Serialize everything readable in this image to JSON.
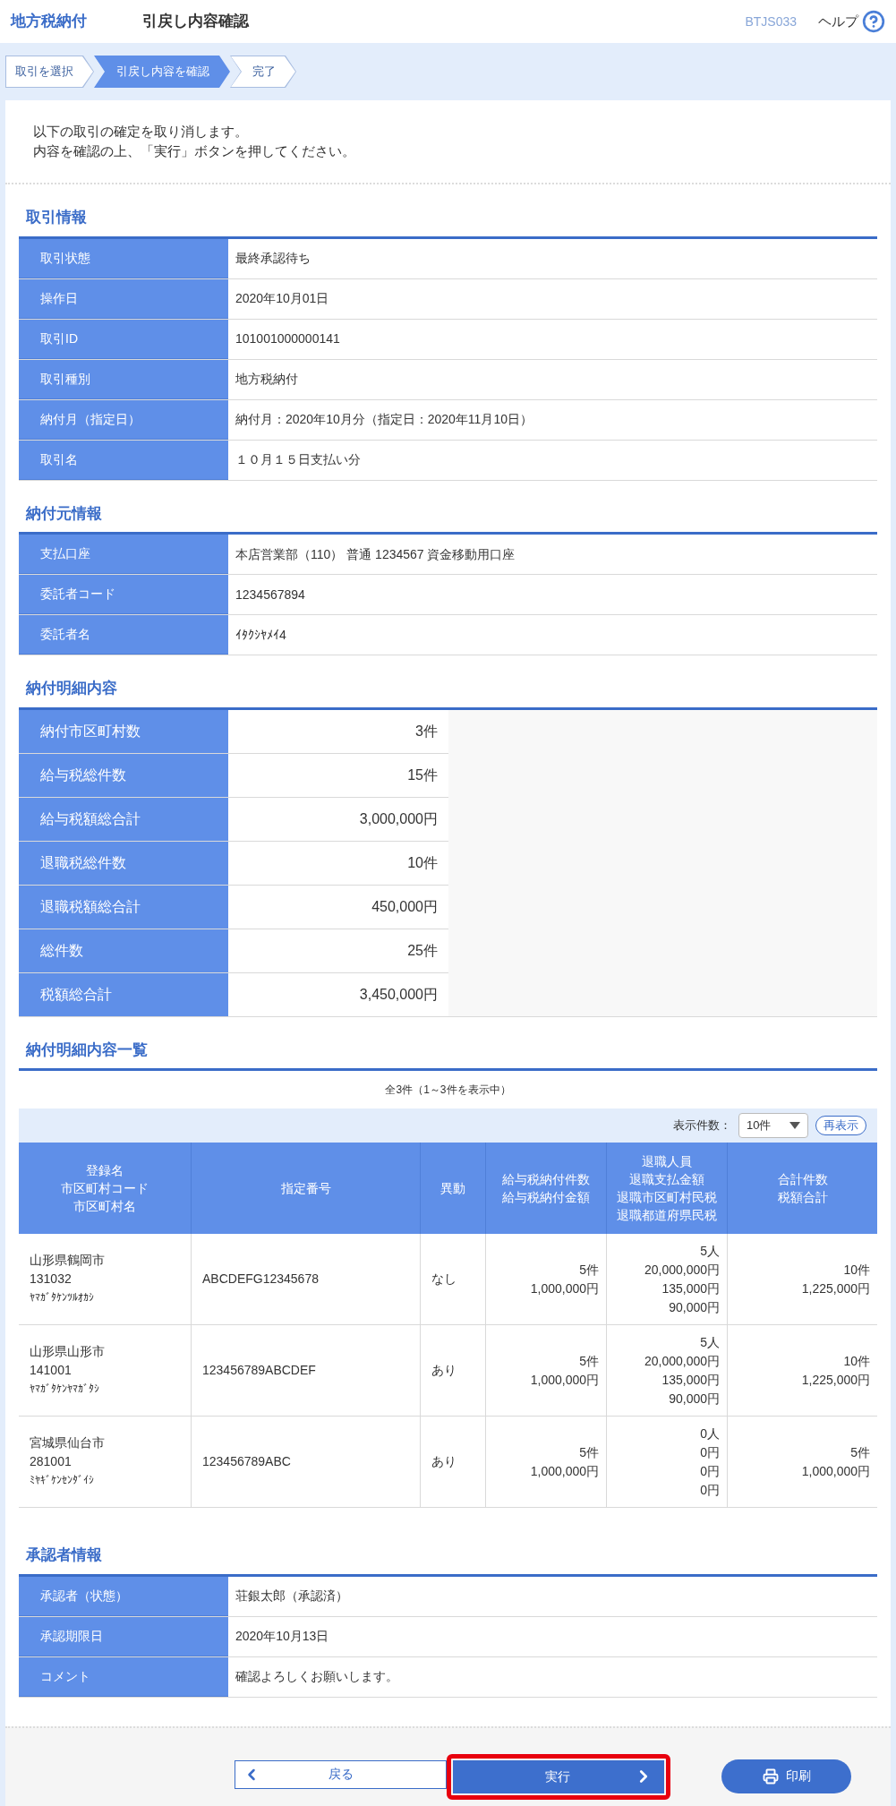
{
  "header": {
    "app_title": "地方税納付",
    "page_title": "引戻し内容確認",
    "screen_id": "BTJS033",
    "help_label": "ヘルプ"
  },
  "steps": [
    {
      "label": "取引を選択",
      "selected": false
    },
    {
      "label": "引戻し内容を確認",
      "selected": true
    },
    {
      "label": "完了",
      "selected": false
    }
  ],
  "message": [
    "以下の取引の確定を取り消します。",
    "内容を確認の上、「実行」ボタンを押してください。"
  ],
  "transaction_info": {
    "title": "取引情報",
    "rows": [
      {
        "label": "取引状態",
        "value": "最終承認待ち"
      },
      {
        "label": "操作日",
        "value": "2020年10月01日"
      },
      {
        "label": "取引ID",
        "value": "101001000000141"
      },
      {
        "label": "取引種別",
        "value": "地方税納付"
      },
      {
        "label": "納付月（指定日）",
        "value": "納付月：2020年10月分（指定日：2020年11月10日）"
      },
      {
        "label": "取引名",
        "value": "１０月１５日支払い分"
      }
    ]
  },
  "payer_info": {
    "title": "納付元情報",
    "rows": [
      {
        "label": "支払口座",
        "value": "本店営業部（110） 普通 1234567 資金移動用口座"
      },
      {
        "label": "委託者コード",
        "value": "1234567894"
      },
      {
        "label": "委託者名",
        "value": "ｲﾀｸｼﾔﾒｲ4"
      }
    ]
  },
  "detail_summary": {
    "title": "納付明細内容",
    "rows": [
      {
        "label": "納付市区町村数",
        "value": "3件"
      },
      {
        "label": "給与税総件数",
        "value": "15件"
      },
      {
        "label": "給与税額総合計",
        "value": "3,000,000円"
      },
      {
        "label": "退職税総件数",
        "value": "10件"
      },
      {
        "label": "退職税額総合計",
        "value": "450,000円"
      },
      {
        "label": "総件数",
        "value": "25件"
      },
      {
        "label": "税額総合計",
        "value": "3,450,000円"
      }
    ]
  },
  "detail_list": {
    "title": "納付明細内容一覧",
    "count_text": "全3件（1～3件を表示中）",
    "per_page_label": "表示件数：",
    "per_page_value": "10件",
    "redisplay_button": "再表示",
    "columns": [
      {
        "lines": [
          "登録名",
          "市区町村コード",
          "市区町村名"
        ]
      },
      {
        "lines": [
          "指定番号"
        ]
      },
      {
        "lines": [
          "異動"
        ]
      },
      {
        "lines": [
          "給与税納付件数",
          "給与税納付金額"
        ]
      },
      {
        "lines": [
          "退職人員",
          "退職支払金額",
          "退職市区町村民税",
          "退職都道府県民税"
        ]
      },
      {
        "lines": [
          "合計件数",
          "税額合計"
        ]
      }
    ],
    "rows": [
      {
        "cells": [
          [
            "山形県鶴岡市",
            "131032",
            "ﾔﾏｶﾞﾀｹﾝﾂﾙｵｶｼ"
          ],
          [
            "ABCDEFG12345678"
          ],
          [
            "なし"
          ],
          [
            "5件",
            "1,000,000円"
          ],
          [
            "5人",
            "20,000,000円",
            "135,000円",
            "90,000円"
          ],
          [
            "10件",
            "1,225,000円"
          ]
        ]
      },
      {
        "cells": [
          [
            "山形県山形市",
            "141001",
            "ﾔﾏｶﾞﾀｹﾝﾔﾏｶﾞﾀｼ"
          ],
          [
            "123456789ABCDEF"
          ],
          [
            "あり"
          ],
          [
            "5件",
            "1,000,000円"
          ],
          [
            "5人",
            "20,000,000円",
            "135,000円",
            "90,000円"
          ],
          [
            "10件",
            "1,225,000円"
          ]
        ]
      },
      {
        "cells": [
          [
            "宮城県仙台市",
            "281001",
            "ﾐﾔｷﾞｹﾝｾﾝﾀﾞｲｼ"
          ],
          [
            "123456789ABC"
          ],
          [
            "あり"
          ],
          [
            "5件",
            "1,000,000円"
          ],
          [
            "0人",
            "0円",
            "0円",
            "0円"
          ],
          [
            "5件",
            "1,000,000円"
          ]
        ]
      }
    ]
  },
  "approver_info": {
    "title": "承認者情報",
    "rows": [
      {
        "label": "承認者（状態）",
        "value": "荘銀太郎（承認済）"
      },
      {
        "label": "承認期限日",
        "value": "2020年10月13日"
      },
      {
        "label": "コメント",
        "value": "確認よろしくお願いします。"
      }
    ]
  },
  "buttons": {
    "back": "戻る",
    "execute": "実行",
    "print": "印刷"
  }
}
